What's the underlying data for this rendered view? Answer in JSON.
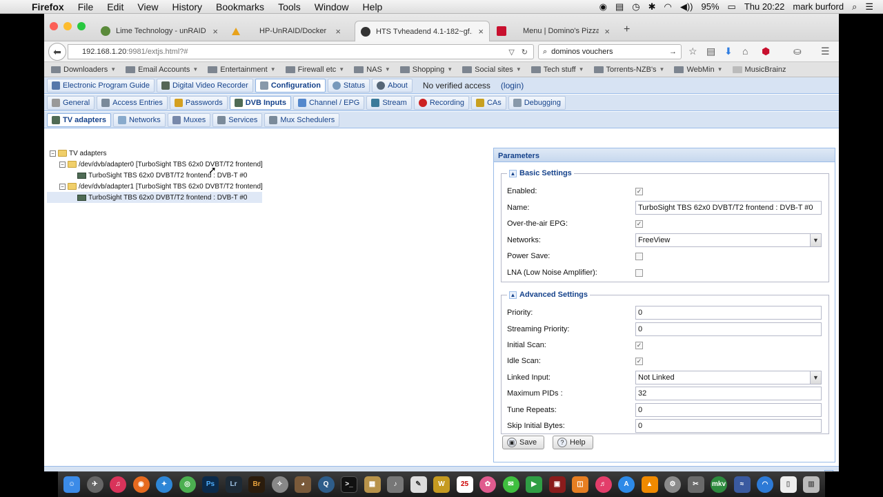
{
  "menubar": {
    "app": "Firefox",
    "items": [
      "File",
      "Edit",
      "View",
      "History",
      "Bookmarks",
      "Tools",
      "Window",
      "Help"
    ],
    "battery": "95%",
    "clock": "Thu 20:22",
    "user": "mark burford"
  },
  "browser": {
    "tabs": [
      {
        "title": "Lime Technology - unRAID ...",
        "close": "×",
        "favicon_color": "#5a8a3a"
      },
      {
        "title": "HP-UnRAID/Docker",
        "close": "×",
        "favicon_color": "#e8a21a"
      },
      {
        "title": "HTS Tvheadend 4.1-182~gf...",
        "close": "×",
        "favicon_color": "#333333"
      },
      {
        "title": "Menu | Domino's Pizza",
        "close": "×",
        "favicon_color": "#c8102e"
      }
    ],
    "new_tab": "+",
    "url_host": "192.168.1.20",
    "url_path": ":9981/extjs.html?#",
    "search_value": "dominos vouchers",
    "bookmarks": [
      "Downloaders",
      "Email Accounts",
      "Entertainment",
      "Firewall etc",
      "NAS",
      "Shopping",
      "Social sites",
      "Tech stuff",
      "Torrents-NZB's",
      "WebMin",
      "MusicBrainz"
    ]
  },
  "app": {
    "top_tabs": [
      "Electronic Program Guide",
      "Digital Video Recorder",
      "Configuration",
      "Status",
      "About"
    ],
    "access_text": "No verified access",
    "login_text": "(login)",
    "config_tabs": [
      "General",
      "Access Entries",
      "Passwords",
      "DVB Inputs",
      "Channel / EPG",
      "Stream",
      "Recording",
      "CAs",
      "Debugging"
    ],
    "dvb_tabs": [
      "TV adapters",
      "Networks",
      "Muxes",
      "Services",
      "Mux Schedulers"
    ],
    "tree": {
      "root": "TV adapters",
      "adapter0": "/dev/dvb/adapter0 [TurboSight TBS 62x0 DVBT/T2 frontend]",
      "frontend0": "TurboSight TBS 62x0 DVBT/T2 frontend : DVB-T #0",
      "adapter1": "/dev/dvb/adapter1 [TurboSight TBS 62x0 DVBT/T2 frontend]",
      "frontend1": "TurboSight TBS 62x0 DVBT/T2 frontend : DVB-T #0"
    },
    "params": {
      "title": "Parameters",
      "basic_title": "Basic Settings",
      "basic": {
        "enabled_label": "Enabled:",
        "enabled": true,
        "name_label": "Name:",
        "name_value": "TurboSight TBS 62x0 DVBT/T2 frontend : DVB-T #0",
        "ota_label": "Over-the-air EPG:",
        "ota": true,
        "networks_label": "Networks:",
        "networks_value": "FreeView",
        "power_label": "Power Save:",
        "power": false,
        "lna_label": "LNA (Low Noise Amplifier):",
        "lna": false
      },
      "advanced_title": "Advanced Settings",
      "advanced": {
        "priority_label": "Priority:",
        "priority_value": "0",
        "stream_priority_label": "Streaming Priority:",
        "stream_priority_value": "0",
        "initial_scan_label": "Initial Scan:",
        "initial_scan": true,
        "idle_scan_label": "Idle Scan:",
        "idle_scan": true,
        "linked_label": "Linked Input:",
        "linked_value": "Not Linked",
        "max_pids_label": "Maximum PIDs :",
        "max_pids_value": "32",
        "tune_repeats_label": "Tune Repeats:",
        "tune_repeats_value": "0",
        "skip_bytes_label": "Skip Initial Bytes:",
        "skip_bytes_value": "0"
      },
      "save_label": "Save",
      "help_label": "Help"
    }
  },
  "dock": {
    "apps": [
      "finder",
      "launchpad",
      "iTunes-radio",
      "firefox",
      "safari",
      "chrome",
      "Ps",
      "Lr",
      "Br",
      "compass",
      "gimp",
      "quicktime",
      "terminal",
      "archive",
      "music",
      "pen",
      "webdav",
      "calendar",
      "photos",
      "messages",
      "facetime",
      "photobooth",
      "books",
      "itunes",
      "appstore",
      "vlc",
      "preferences",
      "tools",
      "mkv",
      "wifi-utility",
      "network",
      "documents",
      "trash"
    ],
    "calendar_day": "25",
    "ps_label": "Ps",
    "lr_label": "Lr",
    "br_label": "Br"
  },
  "colors": {
    "ext_toolbar": "#d7e3f3",
    "ext_border": "#99bbe8",
    "ext_text": "#15428b"
  }
}
